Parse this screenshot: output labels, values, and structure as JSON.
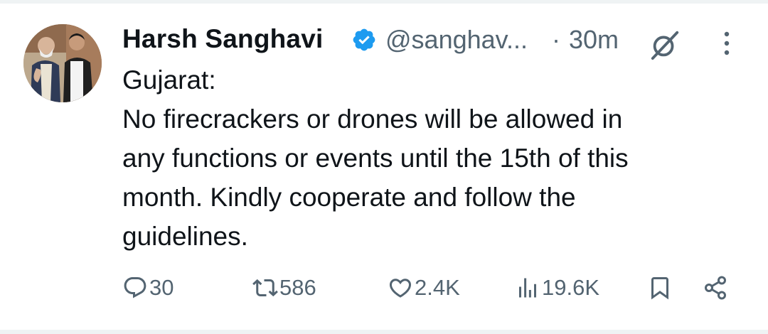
{
  "tweet": {
    "author": {
      "name": "Harsh Sanghavi",
      "handle": "@sanghav...",
      "verified": true,
      "avatar_icon": "profile-photo"
    },
    "time_separator": "·",
    "time": "30m",
    "lines": [
      "Gujarat:",
      "No firecrackers or drones will be allowed in",
      "any functions or events until the 15th of this",
      "month. Kindly cooperate and follow the",
      "guidelines."
    ],
    "actions": {
      "replies": "30",
      "reposts": "586",
      "likes": "2.4K",
      "views": "19.6K"
    }
  },
  "colors": {
    "text": "#0f1419",
    "secondary": "#536471",
    "verified": "#1d9bf0",
    "divider": "#eff3f4"
  }
}
